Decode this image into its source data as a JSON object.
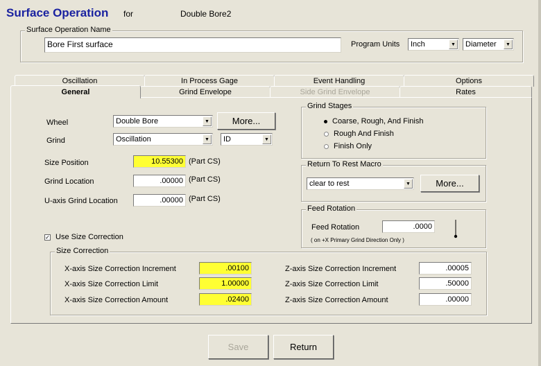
{
  "header": {
    "title": "Surface Operation",
    "for_label": "for",
    "for_value": "Double Bore2"
  },
  "name_group": {
    "title": "Surface Operation Name",
    "name_value": "Bore First surface",
    "program_units_label": "Program Units",
    "units_value": "Inch",
    "mode_value": "Diameter"
  },
  "tabs_back": [
    "Oscillation",
    "In Process Gage",
    "Event Handling",
    "Options"
  ],
  "tabs_front": [
    "General",
    "Grind Envelope",
    "Side Grind Envelope",
    "Rates"
  ],
  "general": {
    "wheel_label": "Wheel",
    "wheel_value": "Double Bore",
    "more_label": "More...",
    "grind_label": "Grind",
    "grind_value": "Oscillation",
    "grind_side_value": "ID",
    "size_position_label": "Size Position",
    "size_position_value": "10.55300",
    "grind_location_label": "Grind Location",
    "grind_location_value": ".00000",
    "u_axis_label": "U-axis Grind Location",
    "u_axis_value": ".00000",
    "part_cs": "(Part CS)",
    "use_size_correction_label": "Use Size Correction",
    "use_size_correction_mark": "✓"
  },
  "grind_stages": {
    "title": "Grind Stages",
    "options": [
      "Coarse, Rough, And Finish",
      "Rough And Finish",
      "Finish Only"
    ]
  },
  "return_to_rest": {
    "title": "Return To Rest Macro",
    "value": "clear to rest",
    "more_label": "More..."
  },
  "feed_rotation": {
    "title": "Feed Rotation",
    "label": "Feed Rotation",
    "value": ".0000",
    "note": "( on +X Primary Grind Direction Only )"
  },
  "size_correction": {
    "title": "Size Correction",
    "x_increment_label": "X-axis Size Correction Increment",
    "x_increment_value": ".00100",
    "x_limit_label": "X-axis Size Correction Limit",
    "x_limit_value": "1.00000",
    "x_amount_label": "X-axis Size Correction Amount",
    "x_amount_value": ".02400",
    "z_increment_label": "Z-axis Size Correction Increment",
    "z_increment_value": ".00005",
    "z_limit_label": "Z-axis Size Correction Limit",
    "z_limit_value": ".50000",
    "z_amount_label": "Z-axis Size Correction Amount",
    "z_amount_value": ".00000"
  },
  "footer": {
    "save_label": "Save",
    "return_label": "Return"
  },
  "colors": {
    "title": "#1a22a0",
    "highlight": "#ffff33",
    "background": "#e7e4d8"
  }
}
